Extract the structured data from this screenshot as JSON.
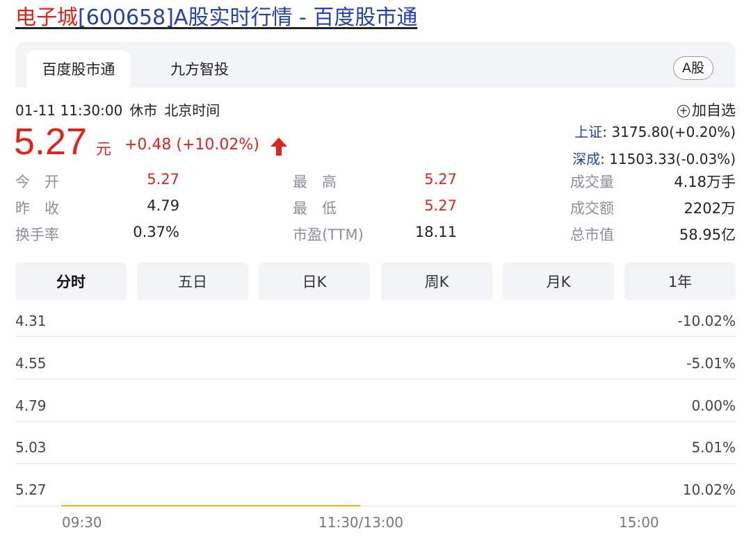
{
  "title": {
    "stock_part": "电子城",
    "rest_part": "[600658]A股实时行情 - 百度股市通"
  },
  "tabs": [
    "百度股市通",
    "九方智投"
  ],
  "market": "A股",
  "status": {
    "datetime": "01-11 11:30:00",
    "state": "休市",
    "tz": "北京时间"
  },
  "add_watchlist": "加自选",
  "quote": {
    "price": "5.27",
    "unit": "元",
    "change": "+0.48 (+10.02%)",
    "direction": "up"
  },
  "indices": [
    {
      "name": "上证",
      "value": ": 3175.80(+0.20%)"
    },
    {
      "name": "深成",
      "value": ": 11503.33(-0.03%)"
    }
  ],
  "stats": [
    {
      "label": "今　开",
      "value": "5.27"
    },
    {
      "label": "最　高",
      "value": "5.27"
    },
    {
      "label": "成交量",
      "value": "4.18万手"
    },
    {
      "label": "昨　收",
      "value": "4.79"
    },
    {
      "label": "最　低",
      "value": "5.27"
    },
    {
      "label": "成交额",
      "value": "2202万"
    },
    {
      "label": "换手率",
      "value": "0.37%"
    },
    {
      "label": "市盈(TTM)",
      "value": "18.11"
    },
    {
      "label": "总市值",
      "value": "58.95亿"
    }
  ],
  "periods": [
    "分时",
    "五日",
    "日K",
    "周K",
    "月K",
    "1年"
  ],
  "chart_data": {
    "type": "line",
    "y_left_ticks": [
      "4.31",
      "4.55",
      "4.79",
      "5.03",
      "5.27"
    ],
    "y_right_ticks": [
      "-10.02%",
      "-5.01%",
      "0.00%",
      "5.01%",
      "10.02%"
    ],
    "x_ticks": [
      "09:30",
      "11:30/13:00",
      "15:00"
    ],
    "series": [
      {
        "x": [
          "09:30",
          "11:30"
        ],
        "values": [
          5.27,
          5.27
        ]
      }
    ]
  },
  "colors": {
    "up": "#e0241b",
    "link": "#2440b3",
    "line": "#e6b422"
  }
}
